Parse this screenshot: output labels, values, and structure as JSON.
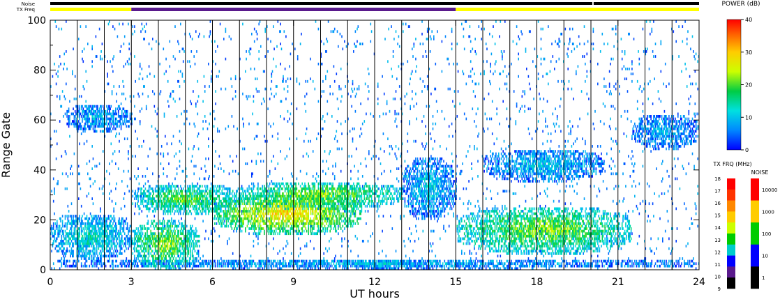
{
  "chart_data": {
    "type": "heatmap",
    "xlabel": "UT hours",
    "ylabel": "Range Gate",
    "xlim": [
      0,
      24
    ],
    "ylim": [
      0,
      100
    ],
    "xticks": [
      0,
      3,
      6,
      9,
      12,
      15,
      18,
      21,
      24
    ],
    "yticks": [
      0,
      20,
      40,
      60,
      80,
      100
    ],
    "x_tick_labels": [
      "0",
      "3",
      "6",
      "9",
      "12",
      "15",
      "18",
      "21",
      "24"
    ],
    "y_tick_labels": [
      "0",
      "20",
      "40",
      "60",
      "80",
      "100"
    ],
    "scan_boundaries_ut": [
      1,
      2,
      3,
      4,
      5,
      6,
      7,
      8,
      9,
      10,
      11,
      12,
      13,
      14,
      15,
      16,
      17,
      18,
      19,
      20,
      21,
      22,
      23
    ],
    "status_bars": {
      "noise_label": "Noise",
      "txfreq_label": "TX Freq",
      "noise_segments": [
        {
          "start": 0,
          "end": 20.05,
          "color": "#000000"
        },
        {
          "start": 20.1,
          "end": 24,
          "color": "#000000"
        }
      ],
      "txfreq_segments": [
        {
          "start": 0,
          "end": 3,
          "color": "#ffff00"
        },
        {
          "start": 3,
          "end": 15,
          "color": "#5a1a8c"
        },
        {
          "start": 15,
          "end": 24,
          "color": "#ffff00"
        }
      ]
    },
    "echo_regions": [
      {
        "t0": 0,
        "t1": 3,
        "g0": 4,
        "g1": 22,
        "p": 12
      },
      {
        "t0": 0.5,
        "t1": 3,
        "g0": 55,
        "g1": 66,
        "p": 8
      },
      {
        "t0": 3,
        "t1": 5.5,
        "g0": 0,
        "g1": 20,
        "p": 20
      },
      {
        "t0": 3,
        "t1": 7,
        "g0": 22,
        "g1": 34,
        "p": 18
      },
      {
        "t0": 6,
        "t1": 11.5,
        "g0": 14,
        "g1": 30,
        "p": 26
      },
      {
        "t0": 7,
        "t1": 13,
        "g0": 24,
        "g1": 35,
        "p": 20
      },
      {
        "t0": 11,
        "t1": 13.5,
        "g0": 0,
        "g1": 4,
        "p": 10
      },
      {
        "t0": 13,
        "t1": 15,
        "g0": 20,
        "g1": 45,
        "p": 9
      },
      {
        "t0": 15,
        "t1": 21.5,
        "g0": 6,
        "g1": 25,
        "p": 20
      },
      {
        "t0": 16,
        "t1": 20.5,
        "g0": 35,
        "g1": 48,
        "p": 9
      },
      {
        "t0": 21.5,
        "t1": 24,
        "g0": 48,
        "g1": 62,
        "p": 8
      },
      {
        "t0": 0,
        "t1": 24,
        "g0": 0,
        "g1": 4,
        "p": 8
      }
    ],
    "colorbars": [
      {
        "title": "POWER (dB)",
        "ticks": [
          "40",
          "30",
          "20",
          "10",
          "0"
        ],
        "range": [
          0,
          40
        ]
      },
      {
        "title": "TX FRQ (MHz)",
        "ticks": [
          "18",
          "17",
          "16",
          "15",
          "14",
          "13",
          "12",
          "11",
          "10",
          "9"
        ],
        "colors": [
          "#ff0000",
          "#ff3300",
          "#ff8800",
          "#ffcc00",
          "#ccff00",
          "#00cc00",
          "#00cccc",
          "#0000ff",
          "#5a1a8c",
          "#000000"
        ]
      },
      {
        "title": "NOISE",
        "ticks": [
          "10000",
          "1000",
          "100",
          "10",
          "1"
        ],
        "colors": [
          "#ff0000",
          "#ffcc00",
          "#00cc00",
          "#0000ff",
          "#000000"
        ]
      }
    ]
  }
}
